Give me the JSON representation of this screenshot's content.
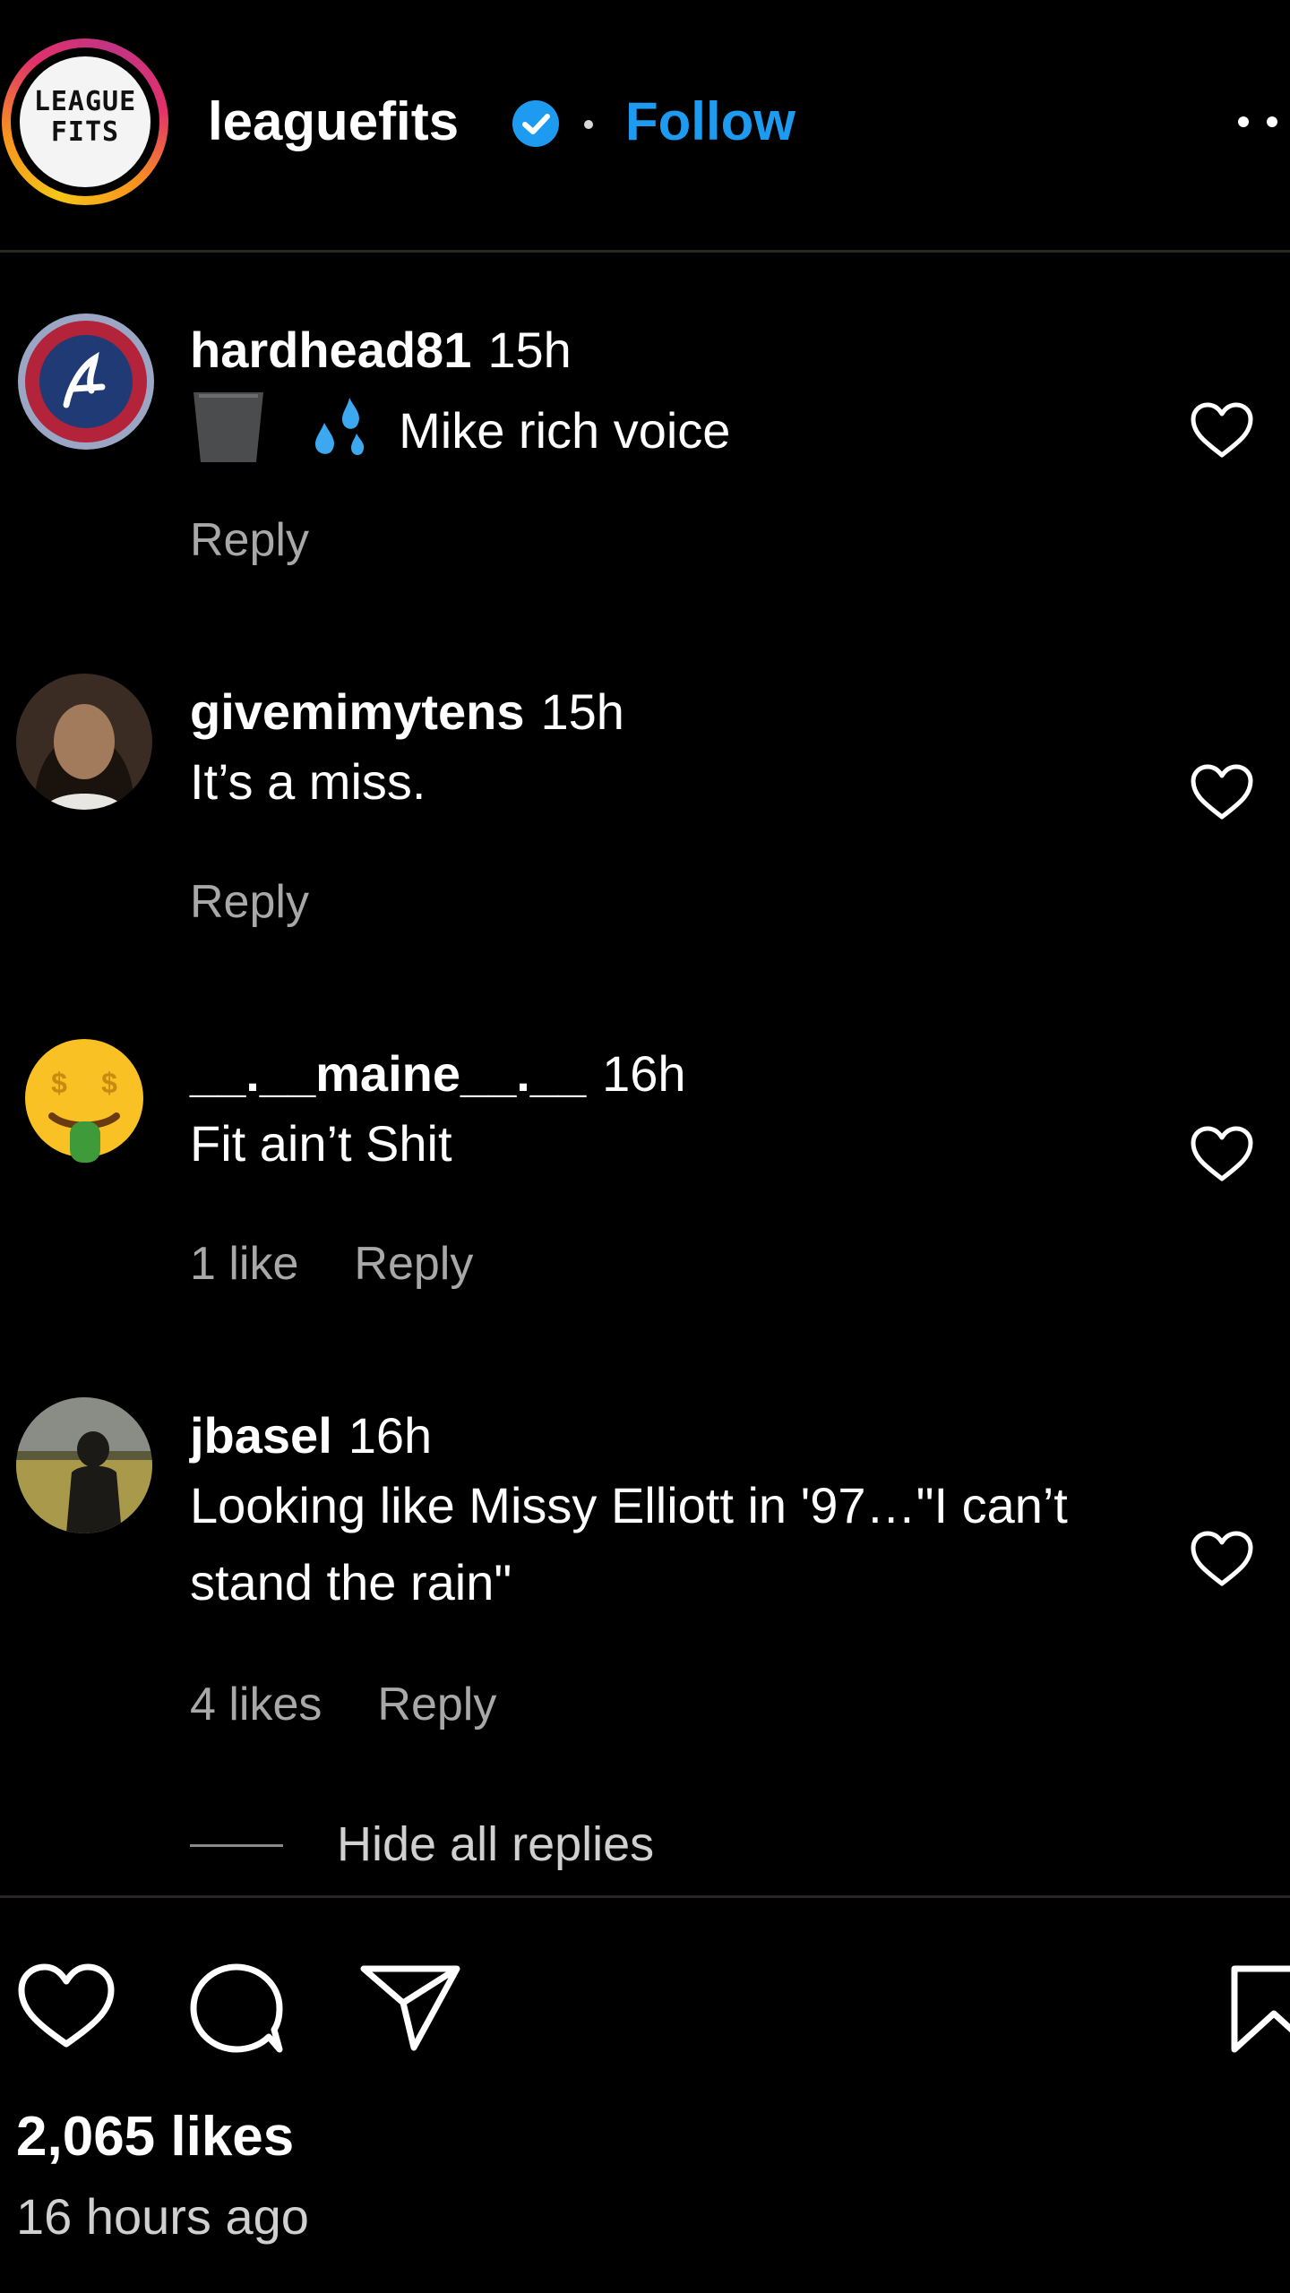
{
  "header": {
    "logo_text": "LEAGUE FITS",
    "username": "leaguefits",
    "verified": true,
    "separator": "•",
    "follow_label": "Follow",
    "more_icon": "more-horizontal-icon"
  },
  "comments": [
    {
      "username": "hardhead81",
      "time": "15h",
      "text": "Mike rich voice",
      "text_prefix_icons": [
        "trash-can-icon",
        "sweat-droplets-emoji"
      ],
      "likes": "",
      "reply_label": "Reply",
      "avatar": "atlanta-braves-logo"
    },
    {
      "username": "givemimytens",
      "time": "15h",
      "text": "It’s a miss.",
      "likes": "",
      "reply_label": "Reply",
      "avatar": "profile-photo"
    },
    {
      "username": "__.__maine__.__",
      "time": "16h",
      "text": "Fit ain’t Shit",
      "likes": "1 like",
      "reply_label": "Reply",
      "avatar": "money-mouth-face-emoji"
    },
    {
      "username": "jbasel",
      "time": "16h",
      "text": "Looking like Missy Elliott in '97…\"I can’t stand the rain\"",
      "likes": "4 likes",
      "reply_label": "Reply",
      "avatar": "profile-photo"
    }
  ],
  "hide_replies_label": "Hide all replies",
  "footer": {
    "likes": "2,065 likes",
    "time_ago": "16 hours ago",
    "icons": [
      "heart-icon",
      "comment-icon",
      "share-icon",
      "bookmark-icon"
    ]
  },
  "colors": {
    "background": "#000000",
    "follow": "#1d9bf0",
    "verified": "#1d9bf0",
    "meta_text": "#a8a8a8"
  }
}
